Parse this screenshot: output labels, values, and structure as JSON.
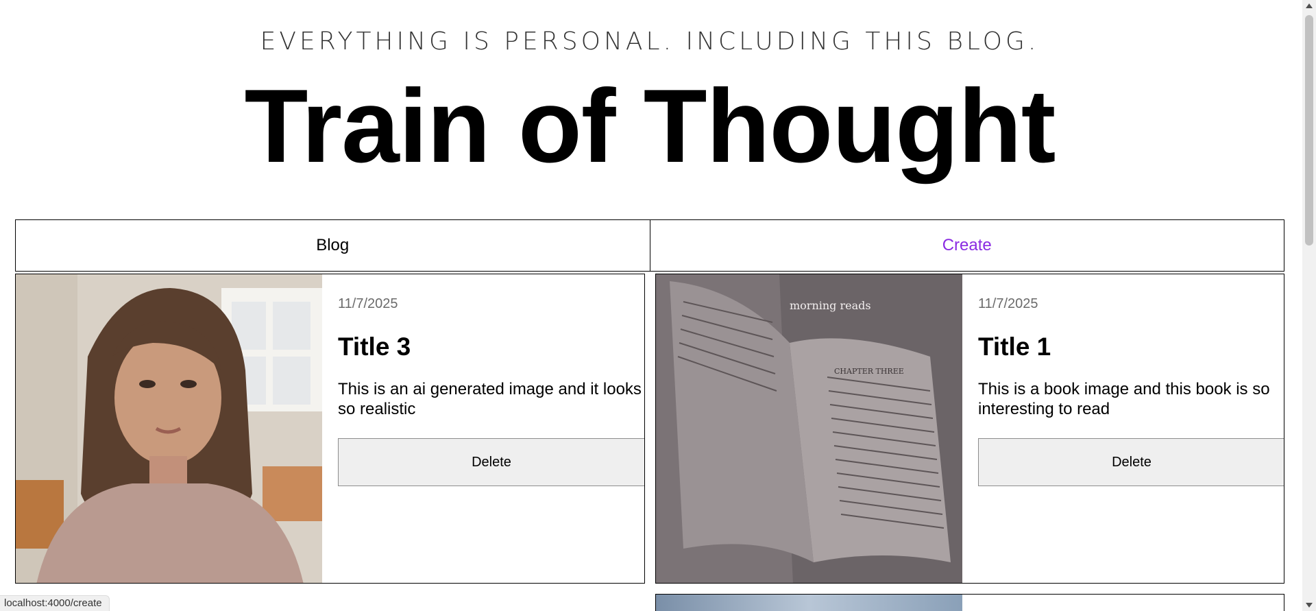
{
  "header": {
    "tagline": "EVERYTHING IS PERSONAL. INCLUDING THIS BLOG.",
    "title": "Train of Thought"
  },
  "nav": {
    "items": [
      {
        "label": "Blog"
      },
      {
        "label": "Create"
      }
    ]
  },
  "posts": [
    {
      "date": "11/7/2025",
      "title": "Title 3",
      "description": "This is an ai generated image and it looks so realistic",
      "delete_label": "Delete",
      "image": "portrait-photo"
    },
    {
      "date": "11/7/2025",
      "title": "Title 1",
      "description": "This is a book image and this book is so interesting to read",
      "delete_label": "Delete",
      "image": "book-photo",
      "image_caption": "morning reads",
      "image_heading": "CHAPTER THREE"
    }
  ],
  "status_bar": {
    "url": "localhost:4000/create"
  },
  "colors": {
    "create_link": "#8a2be2",
    "date_text": "#6b6b6b",
    "button_bg": "#efefef"
  }
}
